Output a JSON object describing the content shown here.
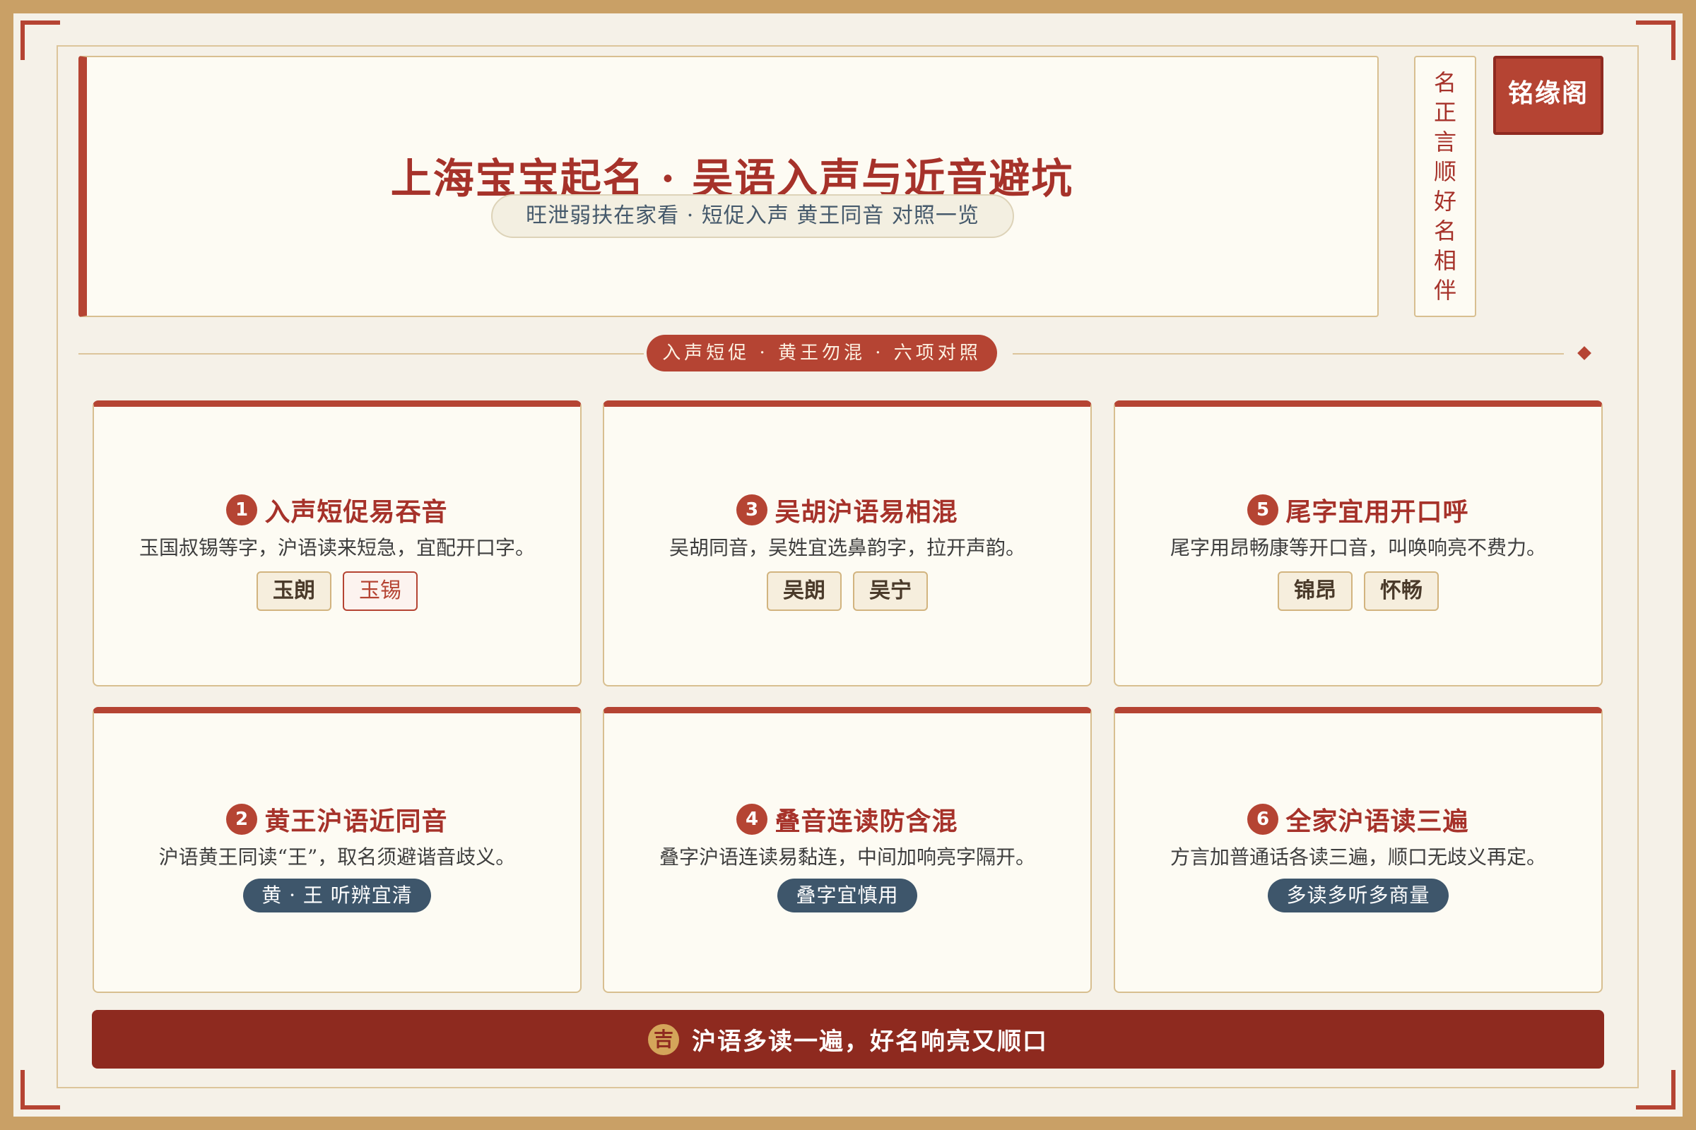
{
  "header": {
    "title": "上海宝宝起名 · 吴语入声与近音避坑",
    "subtitle": "旺泄弱扶在家看 · 短促入声 黄王同音 对照一览"
  },
  "vertical_motto": [
    "名",
    "正",
    "言",
    "顺",
    "好",
    "名",
    "相",
    "伴"
  ],
  "seal": "铭缘阁",
  "divider_label": "入声短促 · 黄王勿混 · 六项对照",
  "cards": [
    {
      "num": "1",
      "title": "入声短促易吞音",
      "desc": "玉国叔锡等字，沪语读来短急，宜配开口字。",
      "tags": [
        "玉朗",
        "玉锡"
      ]
    },
    {
      "num": "3",
      "title": "吴胡沪语易相混",
      "desc": "吴胡同音，吴姓宜选鼻韵字，拉开声韵。",
      "tags": [
        "吴朗",
        "吴宁"
      ]
    },
    {
      "num": "5",
      "title": "尾字宜用开口呼",
      "desc": "尾字用昂畅康等开口音，叫唤响亮不费力。",
      "tags": [
        "锦昂",
        "怀畅"
      ]
    },
    {
      "num": "2",
      "title": "黄王沪语近同音",
      "desc": "沪语黄王同读“王”，取名须避谐音歧义。",
      "badge": "黄 · 王 听辨宜清"
    },
    {
      "num": "4",
      "title": "叠音连读防含混",
      "desc": "叠字沪语连读易黏连，中间加响亮字隔开。",
      "badge": "叠字宜慎用"
    },
    {
      "num": "6",
      "title": "全家沪语读三遍",
      "desc": "方言加普通话各读三遍，顺口无歧义再定。",
      "badge": "多读多听多商量"
    }
  ],
  "footer": {
    "badge": "吉",
    "text": "沪语多读一遍，好名响亮又顺口"
  },
  "colors": {
    "accent": "#b54433",
    "deep_red": "#8e2a1f",
    "navy": "#3e566b",
    "gold": "#c9a066"
  }
}
